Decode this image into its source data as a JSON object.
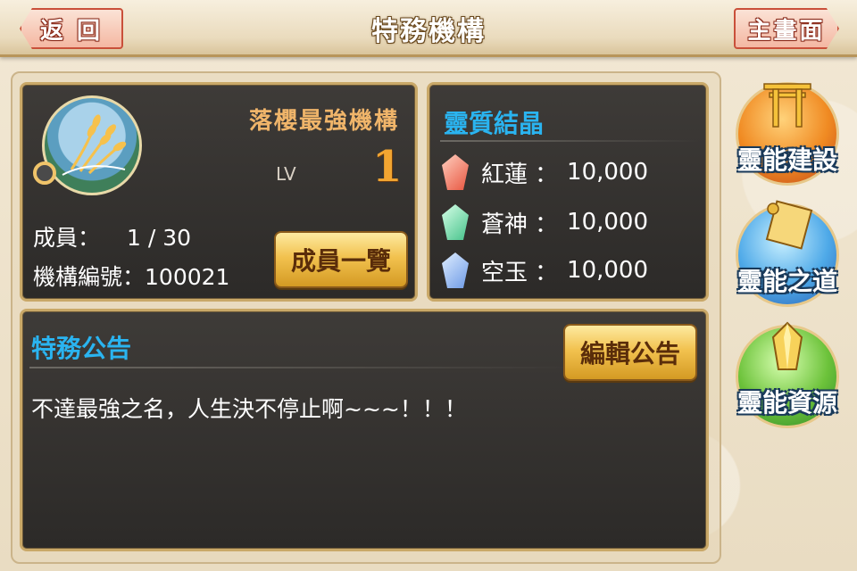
{
  "header": {
    "title": "特務機構",
    "back_label": "返 回",
    "home_label": "主畫面"
  },
  "organization": {
    "name": "落櫻最強機構",
    "level_label": "LV",
    "level": "1",
    "members_label": "成員：",
    "members_value": "1 / 30",
    "id_label": "機構編號：",
    "id_value": "100021",
    "member_list_button": "成員一覽",
    "emblem_icon": "wheat-emblem-icon"
  },
  "crystals": {
    "title": "靈質結晶",
    "items": [
      {
        "name": "紅蓮",
        "separator": "：",
        "value": "10,000",
        "icon": "red-crystal-icon",
        "color": "#e8553f"
      },
      {
        "name": "蒼神",
        "separator": "：",
        "value": "10,000",
        "icon": "green-crystal-icon",
        "color": "#45c28a"
      },
      {
        "name": "空玉",
        "separator": "：",
        "value": "10,000",
        "icon": "blue-crystal-icon",
        "color": "#6d9ae6"
      }
    ]
  },
  "notice": {
    "title": "特務公告",
    "edit_button": "編輯公告",
    "text": "不達最強之名，人生決不停止啊~~~！！！"
  },
  "side_menu": [
    {
      "label": "靈能建設",
      "icon": "torii-gate-icon"
    },
    {
      "label": "靈能之道",
      "icon": "scroll-icon"
    },
    {
      "label": "靈能資源",
      "icon": "gold-crystal-icon"
    }
  ],
  "colors": {
    "accent_blue": "#2ab4f0",
    "org_name": "#f0b56a",
    "level": "#f2a531",
    "panel_border": "#c9a868"
  }
}
